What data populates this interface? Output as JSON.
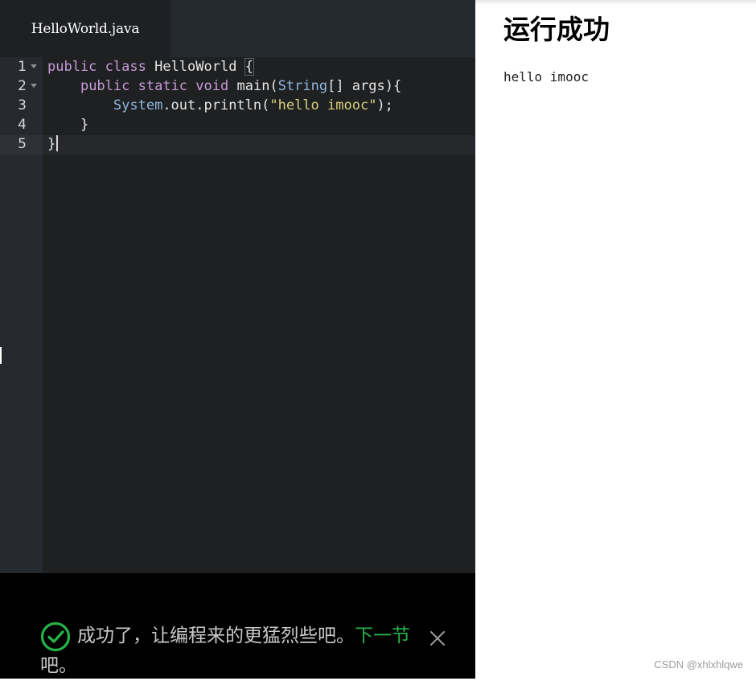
{
  "editor": {
    "tab_label": "HelloWorld.java",
    "line_numbers": [
      "1",
      "2",
      "3",
      "4",
      "5"
    ],
    "lines": [
      {
        "segments": [
          [
            "kw",
            "public"
          ],
          [
            "df",
            " "
          ],
          [
            "kw",
            "class"
          ],
          [
            "df",
            " HelloWorld "
          ],
          [
            "brace",
            "{"
          ]
        ]
      },
      {
        "segments": [
          [
            "df",
            "    "
          ],
          [
            "kw",
            "public"
          ],
          [
            "df",
            " "
          ],
          [
            "kw",
            "static"
          ],
          [
            "df",
            " "
          ],
          [
            "kw",
            "void"
          ],
          [
            "df",
            " main("
          ],
          [
            "ty",
            "String"
          ],
          [
            "df",
            "[] args){"
          ]
        ]
      },
      {
        "segments": [
          [
            "df",
            "        "
          ],
          [
            "ty",
            "System"
          ],
          [
            "df",
            ".out.println("
          ],
          [
            "st",
            "\"hello imooc\""
          ],
          [
            "df",
            ");"
          ]
        ]
      },
      {
        "segments": [
          [
            "df",
            "    }"
          ]
        ]
      },
      {
        "segments": [
          [
            "df",
            "}"
          ],
          [
            "cursor",
            ""
          ]
        ]
      }
    ],
    "colors": {
      "background": "#1f2022",
      "gutter": "#262a2f",
      "keyword": "#c59ad6",
      "type": "#8fb7e0",
      "string": "#d8cf7a"
    }
  },
  "banner": {
    "message": "成功了，让编程来的更猛烈些吧。",
    "link_label": "下一节",
    "trailing": "吧。",
    "check_icon": "check-circle-icon",
    "close_icon": "close-icon",
    "accent_color": "#26b34a"
  },
  "result": {
    "title": "运行成功",
    "output": "hello imooc"
  },
  "watermark": "CSDN @xhlxhlqwe"
}
